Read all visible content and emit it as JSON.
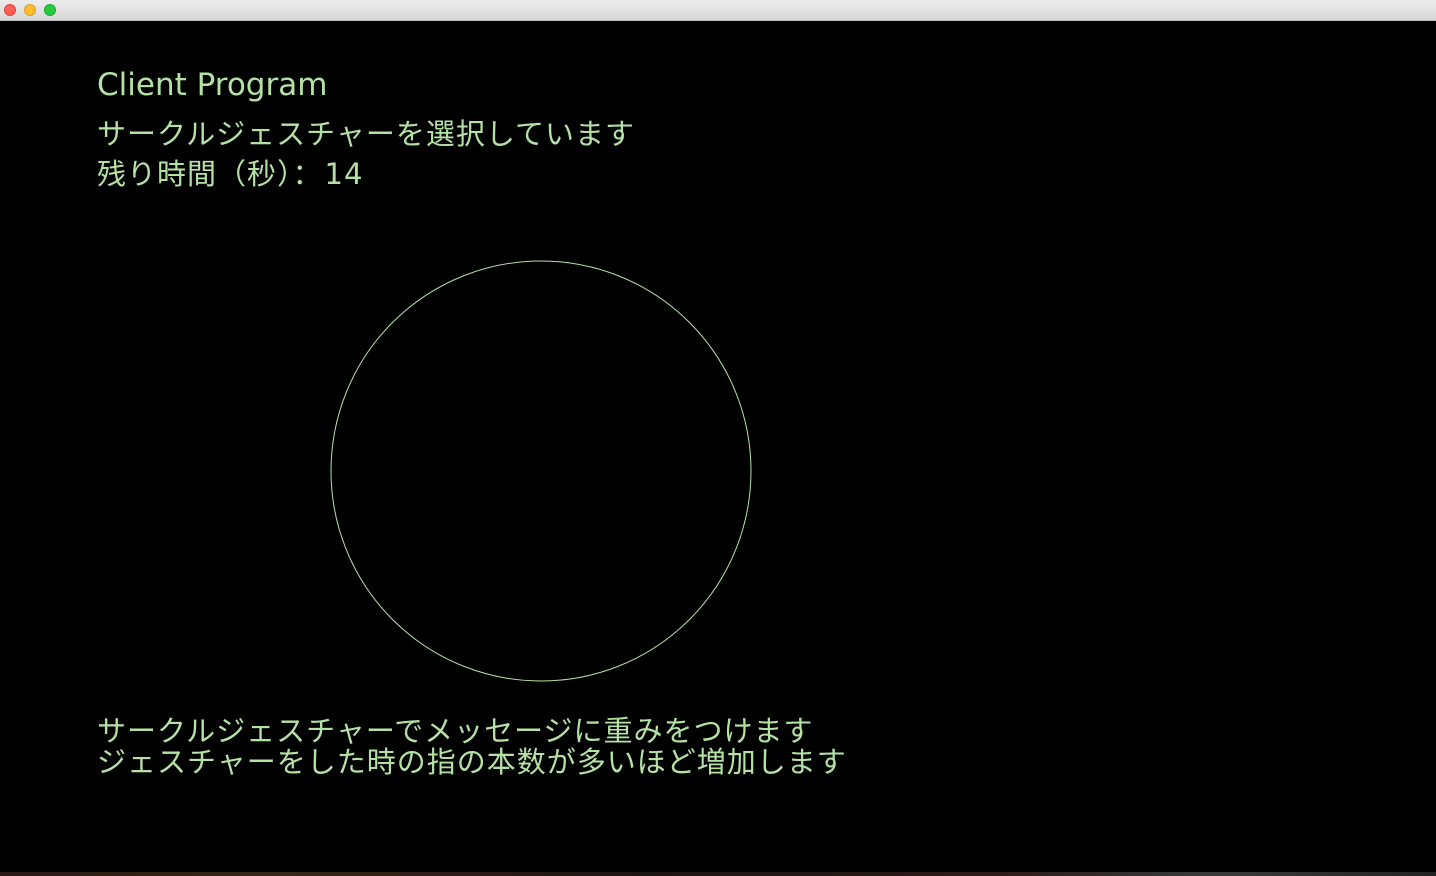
{
  "window": {
    "controls": [
      "close",
      "minimize",
      "zoom"
    ],
    "colors": {
      "close": "#fe5f57",
      "minimize": "#febc2e",
      "zoom": "#28c840"
    }
  },
  "app": {
    "title": "Client Program",
    "status": "サークルジェスチャーを選択しています",
    "timer_label": "残り時間（秒）：",
    "timer_value": "14",
    "info_line1": "サークルジェスチャーでメッセージに重みをつけます",
    "info_line2": "ジェスチャーをした時の指の本数が多いほど増加します"
  },
  "gesture": {
    "shape": "circle",
    "stroke_color": "#b4e2a5"
  },
  "colors": {
    "background": "#000000",
    "text": "#b4e2a5"
  }
}
